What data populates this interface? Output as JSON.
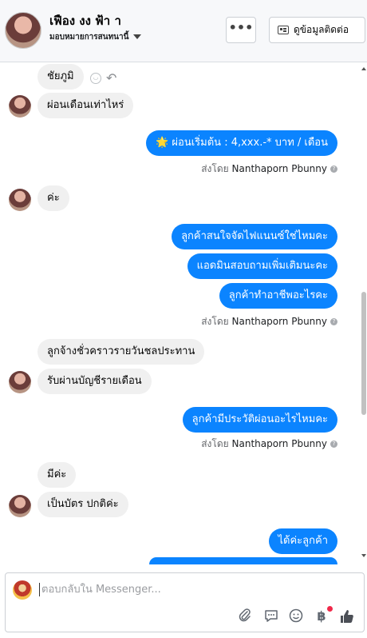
{
  "header": {
    "name": "เฟือง งง ฟ้า า",
    "assign_label": "มอบหมายการสนทนานี้",
    "more_label": "•••",
    "contact_label": "ดูข้อมูลติดต่อ"
  },
  "messages": [
    {
      "side": "in",
      "text": "ชัยภูมิ"
    },
    {
      "side": "in",
      "text": "ผ่อนเดือนเท่าไหร่"
    },
    {
      "side": "out",
      "text": "🌟 ผ่อนเริ่มต้น : 4,xxx.-* บาท / เดือน"
    },
    {
      "side": "in",
      "text": "ค่ะ"
    },
    {
      "side": "out",
      "text": "ลูกค้าสนใจจัดไฟแนนซ์ใช่ไหมคะ"
    },
    {
      "side": "out",
      "text": "แอดมินสอบถามเพิ่มเติมนะคะ"
    },
    {
      "side": "out",
      "text": "ลูกค้าทำอาชีพอะไรคะ"
    },
    {
      "side": "in",
      "text": "ลูกจ้างชั่วคราวรายวันชลประทาน"
    },
    {
      "side": "in",
      "text": "รับผ่านบัญชีรายเดือน"
    },
    {
      "side": "out",
      "text": "ลูกค้ามีประวัติผ่อนอะไรไหมคะ"
    },
    {
      "side": "in",
      "text": "มีค่ะ"
    },
    {
      "side": "in",
      "text": "เป็นบัตร ปกติค่ะ"
    },
    {
      "side": "out",
      "text": "ได้ค่ะลูกค้า"
    }
  ],
  "sent_by": {
    "prefix": "ส่งโดย",
    "agent": "Nanthaporn Pbunny"
  },
  "composer": {
    "placeholder": "ตอบกลับใน Messenger..."
  },
  "icons": [
    "attach-icon",
    "message-icon",
    "emoji-icon",
    "baht-icon",
    "like-icon"
  ],
  "colors": {
    "outgoing": "#0b84ff",
    "incoming": "#f0f0f0",
    "notification": "#f02849"
  }
}
